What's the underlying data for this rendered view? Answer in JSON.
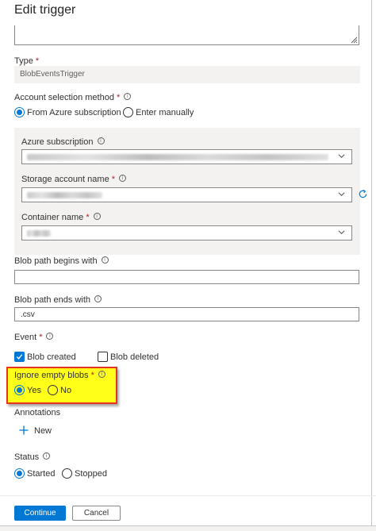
{
  "dialog": {
    "title": "Edit trigger"
  },
  "type": {
    "label": "Type",
    "required": "*",
    "value": "BlobEventsTrigger"
  },
  "account_selection": {
    "label": "Account selection method",
    "required": "*",
    "options": [
      {
        "label": "From Azure subscription",
        "selected": true
      },
      {
        "label": "Enter manually",
        "selected": false
      }
    ]
  },
  "azure_subscription": {
    "label": "Azure subscription"
  },
  "storage_account": {
    "label": "Storage account name",
    "required": "*"
  },
  "container": {
    "label": "Container name",
    "required": "*"
  },
  "blob_begins": {
    "label": "Blob path begins with",
    "value": ""
  },
  "blob_ends": {
    "label": "Blob path ends with",
    "value": ".csv"
  },
  "event": {
    "label": "Event",
    "required": "*",
    "options": [
      {
        "label": "Blob created",
        "checked": true
      },
      {
        "label": "Blob deleted",
        "checked": false
      }
    ]
  },
  "ignore_empty": {
    "label": "Ignore empty blobs",
    "required": "*",
    "options": [
      {
        "label": "Yes",
        "selected": true
      },
      {
        "label": "No",
        "selected": false
      }
    ]
  },
  "annotations": {
    "label": "Annotations",
    "new_label": "New"
  },
  "status": {
    "label": "Status",
    "options": [
      {
        "label": "Started",
        "selected": true
      },
      {
        "label": "Stopped",
        "selected": false
      }
    ]
  },
  "footer": {
    "continue_label": "Continue",
    "cancel_label": "Cancel"
  },
  "colors": {
    "accent": "#0078d4",
    "highlight_fill": "#ffff1a",
    "highlight_border": "#e8331e",
    "required": "#a4262c"
  }
}
